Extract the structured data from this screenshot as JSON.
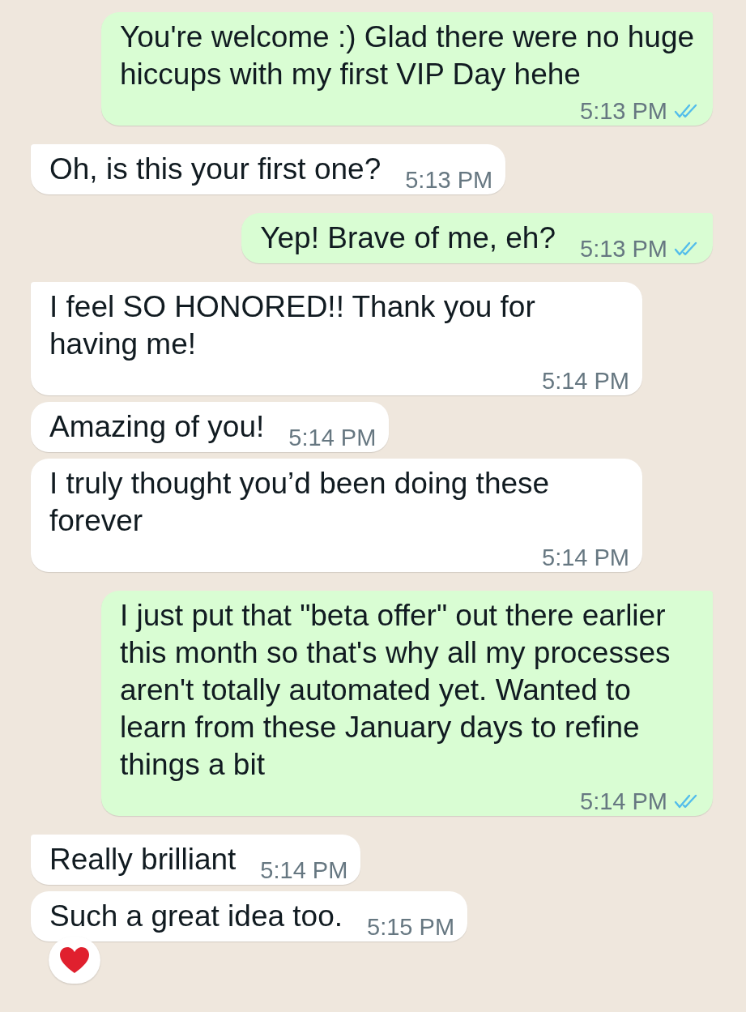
{
  "messages": [
    {
      "kind": "outgoing",
      "text": "You're welcome :) Glad there were no huge hiccups with my first VIP Day hehe",
      "time": "5:13 PM",
      "read": true,
      "reacted": false
    },
    {
      "kind": "incoming",
      "text": "Oh, is this your first one?",
      "time": "5:13 PM",
      "reacted": false
    },
    {
      "kind": "outgoing",
      "text": "Yep! Brave of me, eh?",
      "time": "5:13 PM",
      "read": true,
      "reacted": false
    },
    {
      "kind": "incoming",
      "text": "I feel SO HONORED!! Thank you for having me!",
      "time": "5:14 PM",
      "reacted": false
    },
    {
      "kind": "incoming",
      "text": "Amazing of you!",
      "time": "5:14 PM",
      "reacted": false
    },
    {
      "kind": "incoming",
      "text": "I truly thought you’d been doing these forever",
      "time": "5:14 PM",
      "reacted": false
    },
    {
      "kind": "outgoing",
      "text": "I just put that \"beta offer\" out there earlier this month so that's why all my processes aren't totally automated yet. Wanted to learn from these January days to refine things a bit",
      "time": "5:14 PM",
      "read": true,
      "reacted": false
    },
    {
      "kind": "incoming",
      "text": "Really brilliant",
      "time": "5:14 PM",
      "reacted": false
    },
    {
      "kind": "incoming",
      "text": "Such a great idea too.",
      "time": "5:15 PM",
      "reacted": true
    }
  ]
}
